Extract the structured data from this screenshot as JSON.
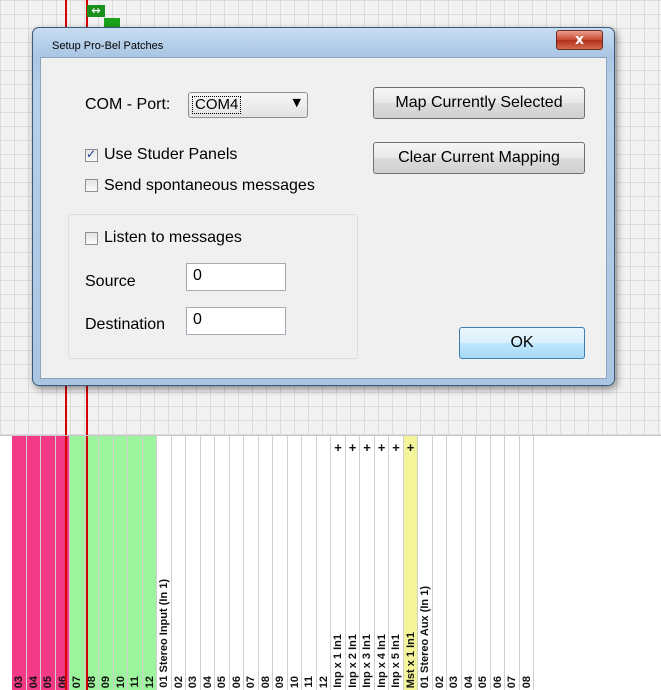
{
  "dialog": {
    "title": "Setup Pro-Bel Patches",
    "close_glyph": "x",
    "com_port": {
      "label": "COM - Port:",
      "value": "COM4",
      "arrow": "▼"
    },
    "use_studer_panels": {
      "label": "Use Studer Panels",
      "checked": true
    },
    "send_spontaneous": {
      "label": "Send spontaneous messages",
      "checked": false
    },
    "listen": {
      "label": "Listen to messages",
      "checked": false
    },
    "source": {
      "label": "Source",
      "value": "0"
    },
    "destination": {
      "label": "Destination",
      "value": "0"
    },
    "map_button": "Map Currently Selected",
    "clear_button": "Clear Current Mapping",
    "ok_button": "OK"
  },
  "matrix": {
    "marker_arrow": "↔",
    "colors": {
      "pink": "#f23a86",
      "green": "#9cf59c",
      "yellow": "#f4f49a",
      "red": "#d40000"
    }
  },
  "columns": [
    {
      "label": "03",
      "color": "pink"
    },
    {
      "label": "04",
      "color": "pink"
    },
    {
      "label": "05",
      "color": "pink"
    },
    {
      "label": "06",
      "color": "pink"
    },
    {
      "label": "07",
      "color": "green"
    },
    {
      "label": "08",
      "color": "green"
    },
    {
      "label": "09",
      "color": "green"
    },
    {
      "label": "10",
      "color": "green"
    },
    {
      "label": "11",
      "color": "green"
    },
    {
      "label": "12",
      "color": "green"
    },
    {
      "label": "01 Stereo Input (In 1)",
      "color": "white"
    },
    {
      "label": "02",
      "color": "white"
    },
    {
      "label": "03",
      "color": "white"
    },
    {
      "label": "04",
      "color": "white"
    },
    {
      "label": "05",
      "color": "white"
    },
    {
      "label": "06",
      "color": "white"
    },
    {
      "label": "07",
      "color": "white"
    },
    {
      "label": "08",
      "color": "white"
    },
    {
      "label": "09",
      "color": "white"
    },
    {
      "label": "10",
      "color": "white"
    },
    {
      "label": "11",
      "color": "white"
    },
    {
      "label": "12",
      "color": "white"
    },
    {
      "label": "Inp x 1 In1",
      "color": "white",
      "plus": "+"
    },
    {
      "label": "Inp x 2 In1",
      "color": "white",
      "plus": "+"
    },
    {
      "label": "Inp x 3 In1",
      "color": "white",
      "plus": "+"
    },
    {
      "label": "Inp x 4 In1",
      "color": "white",
      "plus": "+"
    },
    {
      "label": "Inp x 5 In1",
      "color": "white",
      "plus": "+"
    },
    {
      "label": "Mst x 1 In1",
      "color": "yellow",
      "plus": "+"
    },
    {
      "label": "01 Stereo Aux (In 1)",
      "color": "white"
    },
    {
      "label": "02",
      "color": "white"
    },
    {
      "label": "03",
      "color": "white"
    },
    {
      "label": "04",
      "color": "white"
    },
    {
      "label": "05",
      "color": "white"
    },
    {
      "label": "06",
      "color": "white"
    },
    {
      "label": "07",
      "color": "white"
    },
    {
      "label": "08",
      "color": "white"
    }
  ]
}
